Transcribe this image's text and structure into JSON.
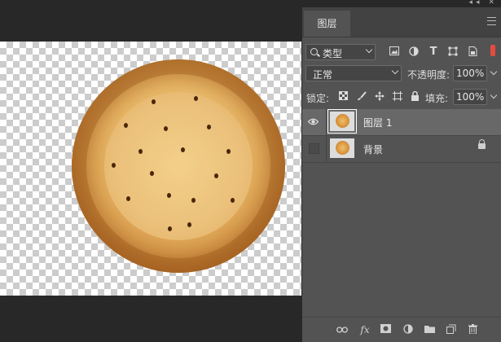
{
  "top_bar": {
    "collapse_glyph": "◂◂",
    "close_glyph": "✕"
  },
  "panel": {
    "tab_label": "图层",
    "filter": {
      "selected": "类型"
    },
    "blend_mode": {
      "selected": "正常"
    },
    "opacity": {
      "label": "不透明度:",
      "value": "100%"
    },
    "lock": {
      "label": "锁定:"
    },
    "fill": {
      "label": "填充:",
      "value": "100%"
    },
    "layers": [
      {
        "name": "图层 1",
        "visible": true,
        "selected": true,
        "locked": false
      },
      {
        "name": "背景",
        "visible": false,
        "selected": false,
        "locked": true
      }
    ],
    "filter_icons": [
      "image-filter-icon",
      "adjustment-filter-icon",
      "type-filter-icon",
      "shape-filter-icon",
      "smart-object-filter-icon"
    ],
    "bottom_icons": [
      "link-icon",
      "fx-icon",
      "mask-icon",
      "adjustment-icon",
      "group-folder-icon",
      "new-layer-icon",
      "trash-icon"
    ]
  },
  "colors": {
    "panel_bg": "#535353",
    "selected_row": "#686868",
    "canvas_bg": "#282828",
    "toggle_red": "#e54b3c"
  }
}
